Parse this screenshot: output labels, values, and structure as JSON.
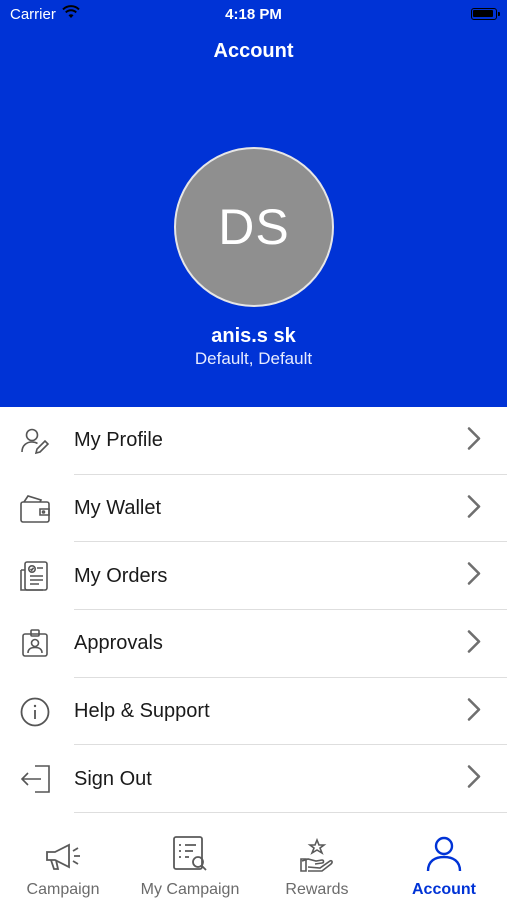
{
  "status_bar": {
    "carrier": "Carrier",
    "time": "4:18 PM"
  },
  "header": {
    "title": "Account",
    "avatar_initials": "DS",
    "user_name": "anis.s sk",
    "user_subtitle": "Default, Default",
    "background_color": "#0033d6",
    "avatar_color": "#8f8f8f"
  },
  "menu": {
    "items": [
      {
        "label": "My Profile",
        "icon": "profile-edit-icon"
      },
      {
        "label": "My Wallet",
        "icon": "wallet-icon"
      },
      {
        "label": "My Orders",
        "icon": "orders-icon"
      },
      {
        "label": "Approvals",
        "icon": "approvals-icon"
      },
      {
        "label": "Help & Support",
        "icon": "info-icon"
      },
      {
        "label": "Sign Out",
        "icon": "sign-out-icon"
      }
    ]
  },
  "tab_bar": {
    "active_color": "#0033d6",
    "tabs": [
      {
        "label": "Campaign",
        "icon": "megaphone-icon",
        "active": false
      },
      {
        "label": "My Campaign",
        "icon": "campaign-list-icon",
        "active": false
      },
      {
        "label": "Rewards",
        "icon": "rewards-hand-icon",
        "active": false
      },
      {
        "label": "Account",
        "icon": "person-icon",
        "active": true
      }
    ]
  }
}
